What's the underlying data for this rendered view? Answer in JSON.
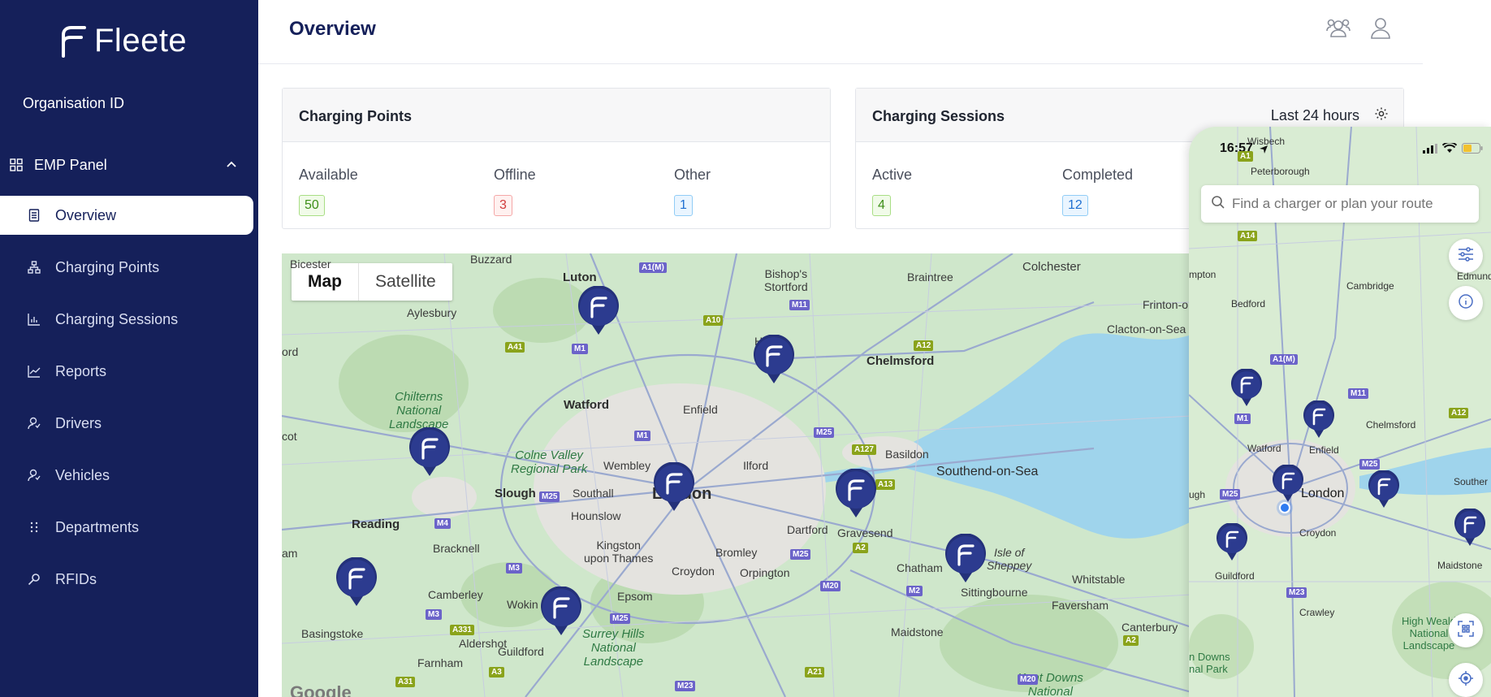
{
  "brand": {
    "name": "Fleete"
  },
  "sidebar": {
    "org_label": "Organisation ID",
    "panel_label": "EMP Panel",
    "items": [
      {
        "label": "Overview",
        "icon": "document-icon",
        "active": true
      },
      {
        "label": "Charging Points",
        "icon": "network-icon"
      },
      {
        "label": "Charging Sessions",
        "icon": "bar-chart-icon"
      },
      {
        "label": "Reports",
        "icon": "line-chart-icon"
      },
      {
        "label": "Drivers",
        "icon": "person-icon"
      },
      {
        "label": "Vehicles",
        "icon": "person-icon"
      },
      {
        "label": "Departments",
        "icon": "grid-dots-icon"
      },
      {
        "label": "RFIDs",
        "icon": "search-key-icon"
      }
    ]
  },
  "header": {
    "title": "Overview"
  },
  "charging_points": {
    "title": "Charging Points",
    "stats": [
      {
        "label": "Available",
        "value": "50"
      },
      {
        "label": "Offline",
        "value": "3"
      },
      {
        "label": "Other",
        "value": "1"
      }
    ]
  },
  "charging_sessions": {
    "title": "Charging Sessions",
    "range": "Last 24 hours",
    "stats": [
      {
        "label": "Active",
        "value": "4"
      },
      {
        "label": "Completed",
        "value": "12"
      }
    ]
  },
  "map": {
    "toggle": {
      "map": "Map",
      "satellite": "Satellite"
    },
    "attribution": "Google",
    "labels": {
      "luton": "Luton",
      "buzzard": "Buzzard",
      "bishops": "Bishop's\nStortford",
      "braintree": "Braintree",
      "colchester": "Colchester",
      "aylesbury": "Aylesbury",
      "frinton": "Frinton-o",
      "clacton": "Clacton-on-Sea",
      "chelmsford": "Chelmsford",
      "chiltern": "Chilterns\nNational\nLandscape",
      "watford": "Watford",
      "enfield": "Enfield",
      "colne": "Colne Valley\nRegional Park",
      "wembley": "Wembley",
      "ilford": "Ilford",
      "basildon": "Basildon",
      "southend": "Southend-on-Sea",
      "slough": "Slough",
      "southall": "Southall",
      "london": "London",
      "reading": "Reading",
      "hounslow": "Hounslow",
      "dartford": "Dartford",
      "gravesend": "Gravesend",
      "bracknell": "Bracknell",
      "kingston": "Kingston\nupon Thames",
      "bromley": "Bromley",
      "sheppey": "Isle of\nSheppey",
      "croydon": "Croydon",
      "orpington": "Orpington",
      "chatham": "Chatham",
      "whitstable": "Whitstable",
      "camberley": "Camberley",
      "woking": "Wokin",
      "epsom": "Epsom",
      "sittingbourne": "Sittingbourne",
      "faversham": "Faversham",
      "surrey": "Surrey Hills\nNational\nLandscape",
      "basingstoke": "Basingstoke",
      "aldershot": "Aldershot",
      "maidstone": "Maidstone",
      "canterbury": "Canterbury",
      "farnham": "Farnham",
      "guildford": "Guildford",
      "kentdowns": "Kent Downs\nNational",
      "bicester": "Bicester",
      "ford": "ord",
      "cot": "cot",
      "am": "am",
      "ha": "Ha"
    },
    "roads": [
      "A1(M)",
      "M11",
      "A10",
      "A41",
      "M1",
      "A12",
      "M25",
      "A127",
      "A13",
      "A2",
      "M4",
      "M3",
      "A331",
      "M20",
      "M2",
      "A31",
      "A3",
      "M23",
      "A21"
    ]
  },
  "phone": {
    "time": "16:57",
    "search_placeholder": "Find a charger or plan your route",
    "labels": {
      "wisbech": "Wisbech",
      "peterborough": "Peterborough",
      "mpton": "mpton",
      "cambridge": "Cambridge",
      "bedford": "Bedford",
      "edmunds": "Edmunds",
      "luton": "n",
      "chelmsford": "Chelmsford",
      "watford": "Watford",
      "enfield": "Enfield",
      "ugh": "ugh",
      "london": "London",
      "southend": "Souther",
      "croydon": "Croydon",
      "guildford": "Guildford",
      "maidstone": "Maidstone",
      "crawley": "Crawley",
      "weald": "High Weald\nNational\nLandscape",
      "downs": "n Downs\nnal Park"
    },
    "roads": [
      "A1",
      "A14",
      "A1(M)",
      "M11",
      "A12",
      "M1",
      "M25",
      "A12",
      "M23"
    ]
  }
}
